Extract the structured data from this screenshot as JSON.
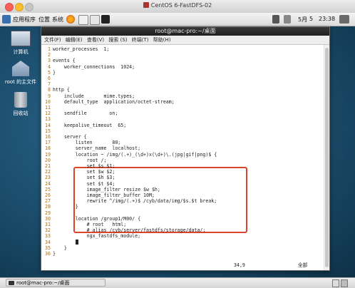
{
  "vm_window": {
    "title": "CentOS 6-FastDFS-02"
  },
  "guest_panel": {
    "menus": [
      "应用程序",
      "位置",
      "系统"
    ],
    "date": "5月",
    "day": "5",
    "time": "23:38"
  },
  "desktop": {
    "icons": [
      "计算机",
      "root 的主文件",
      "回收站"
    ]
  },
  "terminal": {
    "title": "root@mac-pro:~/桌面",
    "menu": [
      "文件(F)",
      "编辑(E)",
      "查看(V)",
      "搜索 (S)",
      "终端(T)",
      "帮助(H)"
    ],
    "lines": [
      {
        "n": "1",
        "t": "worker_processes  1;"
      },
      {
        "n": "2",
        "t": ""
      },
      {
        "n": "3",
        "t": "events {"
      },
      {
        "n": "4",
        "t": "    worker_connections  1024;"
      },
      {
        "n": "5",
        "t": "}"
      },
      {
        "n": "6",
        "t": ""
      },
      {
        "n": "7",
        "t": ""
      },
      {
        "n": "8",
        "t": "http {"
      },
      {
        "n": "9",
        "t": "    include       mime.types;"
      },
      {
        "n": "10",
        "t": "    default_type  application/octet-stream;"
      },
      {
        "n": "11",
        "t": ""
      },
      {
        "n": "12",
        "t": "    sendfile        on;"
      },
      {
        "n": "13",
        "t": ""
      },
      {
        "n": "14",
        "t": "    keepalive_timeout  65;"
      },
      {
        "n": "15",
        "t": ""
      },
      {
        "n": "16",
        "t": "    server {"
      },
      {
        "n": "17",
        "t": "        listen       80;"
      },
      {
        "n": "18",
        "t": "        server_name  localhost;"
      },
      {
        "n": "19",
        "t": "        location ~ /img/(.+)_(\\d+)x(\\d+)\\.(jpg|gif|png)$ {"
      },
      {
        "n": "20",
        "t": "            root /;"
      },
      {
        "n": "21",
        "t": "            set $s $1;"
      },
      {
        "n": "22",
        "t": "            set $w $2;"
      },
      {
        "n": "23",
        "t": "            set $h $3;"
      },
      {
        "n": "24",
        "t": "            set $t $4;"
      },
      {
        "n": "25",
        "t": "            image_filter resize $w $h;"
      },
      {
        "n": "26",
        "t": "            image_filter_buffer 10M;"
      },
      {
        "n": "27",
        "t": "            rewrite ^/img/(.+)$ /cyb/data/img/$s.$t break;"
      },
      {
        "n": "28",
        "t": "        }"
      },
      {
        "n": "29",
        "t": ""
      },
      {
        "n": "30",
        "t": "        location /group1/M00/ {"
      },
      {
        "n": "31",
        "t": "            # root   html;"
      },
      {
        "n": "32",
        "t": "            # alias /cyb/server/fastdfs/storage/data/;"
      },
      {
        "n": "33",
        "t": "            ngx_fastdfs_module;"
      },
      {
        "n": "34",
        "t": "        "
      },
      {
        "n": "35",
        "t": "    }"
      },
      {
        "n": "36",
        "t": "}"
      }
    ],
    "status_pos": "34,9",
    "status_view": "全部"
  },
  "taskbar": {
    "task": "root@mac-pro:~/桌面"
  }
}
